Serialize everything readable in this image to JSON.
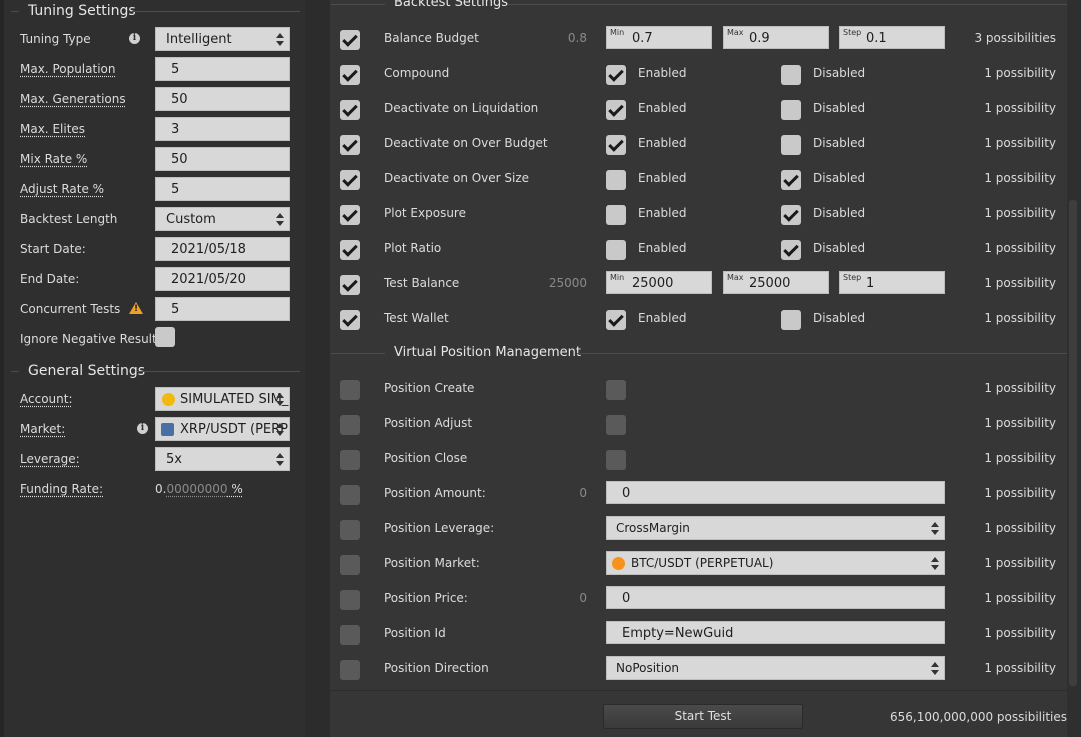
{
  "tuning": {
    "title": "Tuning Settings",
    "type_label": "Tuning Type",
    "type_value": "Intelligent",
    "max_population_label": "Max. Population",
    "max_population": "5",
    "max_generations_label": "Max. Generations",
    "max_generations": "50",
    "max_elites_label": "Max. Elites",
    "max_elites": "3",
    "mix_rate_label": "Mix Rate %",
    "mix_rate": "50",
    "adjust_rate_label": "Adjust Rate %",
    "adjust_rate": "5",
    "backtest_length_label": "Backtest Length",
    "backtest_length": "Custom",
    "start_date_label": "Start Date:",
    "start_date": "2021/05/18",
    "end_date_label": "End Date:",
    "end_date": "2021/05/20",
    "concurrent_label": "Concurrent Tests",
    "concurrent": "5",
    "ignore_negative_label": "Ignore Negative Results"
  },
  "general": {
    "title": "General Settings",
    "account_label": "Account:",
    "account": "SIMULATED SIM_",
    "market_label": "Market:",
    "market": "XRP/USDT (PERP",
    "leverage_label": "Leverage:",
    "leverage": "5x",
    "funding_label": "Funding Rate:",
    "funding_int": "0.",
    "funding_dec": "00000000",
    "funding_pct": " %"
  },
  "backtest": {
    "title": "Backtest Settings",
    "rows": [
      {
        "label": "Balance Budget",
        "checked": true,
        "value": "0.8",
        "min": "0.7",
        "max": "0.9",
        "step": "0.1",
        "poss": "3 possibilities"
      },
      {
        "label": "Compound",
        "checked": true,
        "enabled": true,
        "disabled": false,
        "poss": "1 possibility"
      },
      {
        "label": "Deactivate on Liquidation",
        "checked": true,
        "enabled": true,
        "disabled": false,
        "poss": "1 possibility"
      },
      {
        "label": "Deactivate on Over Budget",
        "checked": true,
        "enabled": true,
        "disabled": false,
        "poss": "1 possibility"
      },
      {
        "label": "Deactivate on Over Size",
        "checked": true,
        "enabled": false,
        "disabled": true,
        "poss": "1 possibility"
      },
      {
        "label": "Plot Exposure",
        "checked": true,
        "enabled": false,
        "disabled": true,
        "poss": "1 possibility"
      },
      {
        "label": "Plot Ratio",
        "checked": true,
        "enabled": false,
        "disabled": true,
        "poss": "1 possibility"
      },
      {
        "label": "Test Balance",
        "checked": true,
        "value": "25000",
        "min": "25000",
        "max": "25000",
        "step": "1",
        "poss": "1 possibility"
      },
      {
        "label": "Test Wallet",
        "checked": true,
        "enabled": true,
        "disabled": false,
        "poss": "1 possibility"
      }
    ],
    "enabled_label": "Enabled",
    "disabled_label": "Disabled",
    "min_tag": "Min",
    "max_tag": "Max",
    "step_tag": "Step"
  },
  "vpm": {
    "title": "Virtual Position Management",
    "rows": [
      {
        "label": "Position Create",
        "poss": "1 possibility"
      },
      {
        "label": "Position Adjust",
        "poss": "1 possibility"
      },
      {
        "label": "Position Close",
        "poss": "1 possibility"
      },
      {
        "label": "Position Amount:",
        "value": "0",
        "field": "0",
        "poss": "1 possibility"
      },
      {
        "label": "Position Leverage:",
        "select": "CrossMargin",
        "poss": "1 possibility"
      },
      {
        "label": "Position Market:",
        "select": "BTC/USDT (PERPETUAL)",
        "poss": "1 possibility"
      },
      {
        "label": "Position Price:",
        "value": "0",
        "field": "0",
        "poss": "1 possibility"
      },
      {
        "label": "Position Id",
        "field": "Empty=NewGuid",
        "poss": "1 possibility"
      },
      {
        "label": "Position Direction",
        "select": "NoPosition",
        "poss": "1 possibility"
      }
    ]
  },
  "footer": {
    "start_label": "Start Test",
    "total": "656,100,000,000 possibilities"
  },
  "colors": {
    "warning": "#f0a020",
    "binance": "#f0b90b",
    "btc": "#f7931a"
  }
}
